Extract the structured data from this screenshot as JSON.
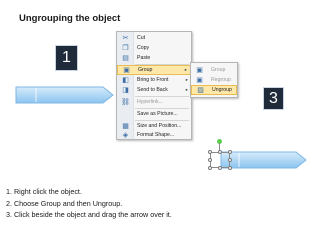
{
  "title": "Ungrouping the object",
  "step_numbers": [
    "1",
    "2",
    "3"
  ],
  "context_menu": {
    "items": [
      {
        "label": "Cut",
        "icon": "scissors-icon",
        "glyph": "✂",
        "dim": false,
        "submenu": false,
        "highlighted": false
      },
      {
        "label": "Copy",
        "icon": "copy-icon",
        "glyph": "❐",
        "dim": false,
        "submenu": false,
        "highlighted": false
      },
      {
        "label": "Paste",
        "icon": "paste-icon",
        "glyph": "▤",
        "dim": false,
        "submenu": false,
        "highlighted": false
      },
      {
        "label": "Group",
        "icon": "group-icon",
        "glyph": "▣",
        "dim": false,
        "submenu": true,
        "highlighted": true
      },
      {
        "label": "Bring to Front",
        "icon": "bring-front-icon",
        "glyph": "◧",
        "dim": false,
        "submenu": true,
        "highlighted": false
      },
      {
        "label": "Send to Back",
        "icon": "send-back-icon",
        "glyph": "◨",
        "dim": false,
        "submenu": true,
        "highlighted": false
      },
      {
        "label": "Hyperlink...",
        "icon": "hyperlink-icon",
        "glyph": "⛓",
        "dim": true,
        "submenu": false,
        "highlighted": false
      },
      {
        "label": "Save as Picture...",
        "icon": "",
        "glyph": "",
        "dim": false,
        "submenu": false,
        "highlighted": false
      },
      {
        "label": "Size and Position...",
        "icon": "size-position-icon",
        "glyph": "▦",
        "dim": false,
        "submenu": false,
        "highlighted": false
      },
      {
        "label": "Format Shape...",
        "icon": "format-shape-icon",
        "glyph": "◈",
        "dim": false,
        "submenu": false,
        "highlighted": false
      }
    ]
  },
  "group_submenu": {
    "items": [
      {
        "label": "Group",
        "icon": "group-icon",
        "glyph": "▣",
        "dim": true,
        "highlighted": false
      },
      {
        "label": "Regroup",
        "icon": "regroup-icon",
        "glyph": "▣",
        "dim": true,
        "highlighted": false
      },
      {
        "label": "Ungroup",
        "icon": "ungroup-icon",
        "glyph": "▨",
        "dim": false,
        "highlighted": true
      }
    ]
  },
  "instructions": [
    "1.  Right click the object.",
    "2.  Choose Group and then Ungroup.",
    "3.  Click beside the object and drag the arrow over it."
  ],
  "colors": {
    "arrow_fill": "#a9d3f5",
    "arrow_stroke": "#5b9bd5",
    "number_box": "#1f2a3a",
    "menu_highlight": "#fde7a9"
  }
}
